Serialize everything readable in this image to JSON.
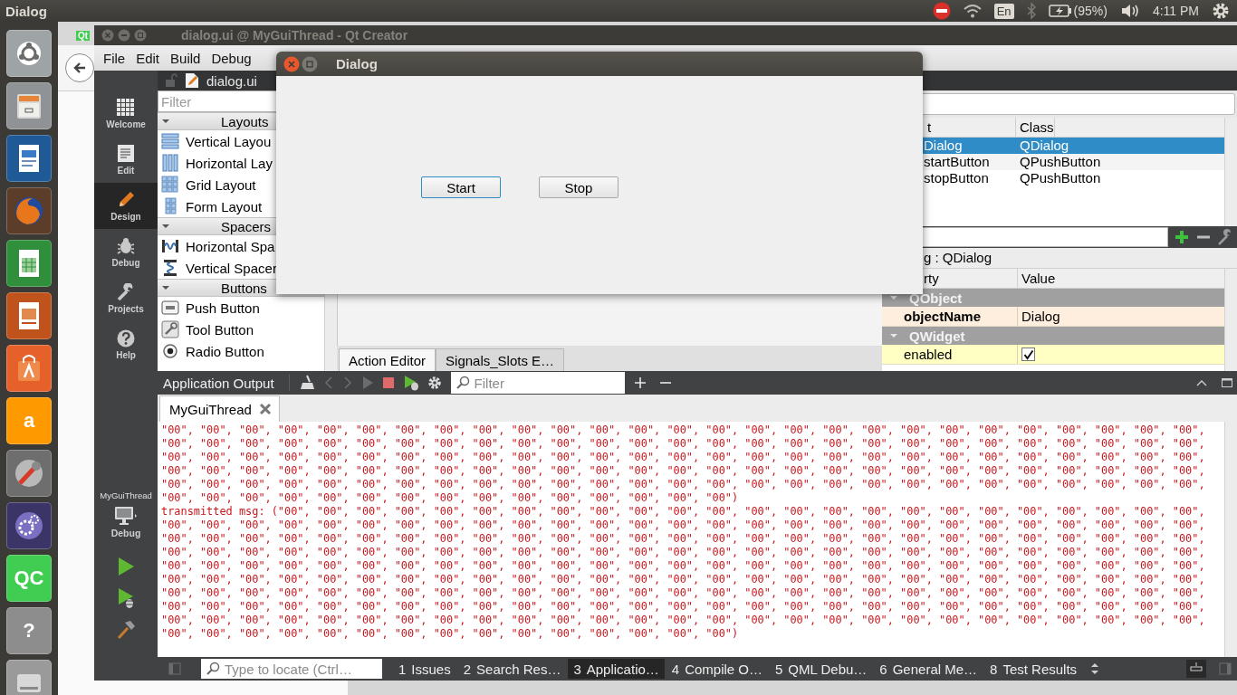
{
  "top_panel": {
    "title": "Dialog",
    "keyboard": "En",
    "battery": "(95%)",
    "clock": "4:11 PM"
  },
  "launcher": [
    {
      "kind": "ubuntu"
    },
    {
      "kind": "files"
    },
    {
      "kind": "writer"
    },
    {
      "kind": "browser"
    },
    {
      "kind": "calc"
    },
    {
      "kind": "impress"
    },
    {
      "kind": "software"
    },
    {
      "kind": "letter",
      "label": "a"
    },
    {
      "kind": "settings"
    },
    {
      "kind": "gears"
    },
    {
      "kind": "letter",
      "label": "QC"
    },
    {
      "kind": "letter",
      "label": "?"
    },
    {
      "kind": "drive"
    }
  ],
  "background_window": {
    "favicon": "Qt"
  },
  "qt_creator": {
    "title": "dialog.ui @ MyGuiThread - Qt Creator",
    "menu": [
      "File",
      "Edit",
      "Build",
      "Debug"
    ],
    "modes": [
      {
        "label": "Welcome",
        "kind": "welcome",
        "selected": false
      },
      {
        "label": "Edit",
        "kind": "edit",
        "selected": false
      },
      {
        "label": "Design",
        "kind": "design",
        "selected": true
      },
      {
        "label": "Debug",
        "kind": "debug",
        "selected": false
      },
      {
        "label": "Projects",
        "kind": "projects",
        "selected": false
      },
      {
        "label": "Help",
        "kind": "help",
        "selected": false
      }
    ],
    "kit": {
      "project": "MyGuiThread",
      "build": "Debug"
    },
    "document": "dialog.ui",
    "widget_box": {
      "placeholder": "Filter",
      "categories": [
        {
          "title": "Layouts",
          "expanded": true,
          "items": [
            {
              "label": "Vertical Layou",
              "kind": "vlayout"
            },
            {
              "label": "Horizontal Lay",
              "kind": "hlayout"
            },
            {
              "label": "Grid Layout",
              "kind": "grid"
            },
            {
              "label": "Form Layout",
              "kind": "form"
            }
          ]
        },
        {
          "title": "Spacers",
          "expanded": true,
          "items": [
            {
              "label": "Horizontal Spa",
              "kind": "hspacer"
            },
            {
              "label": "Vertical Spacer",
              "kind": "vspacer"
            }
          ]
        },
        {
          "title": "Buttons",
          "expanded": true,
          "items": [
            {
              "label": "Push Button",
              "kind": "push"
            },
            {
              "label": "Tool Button",
              "kind": "tool"
            },
            {
              "label": "Radio Button",
              "kind": "radio"
            }
          ]
        }
      ]
    },
    "form_tabs": [
      {
        "label": "Action Editor",
        "selected": true
      },
      {
        "label": "Signals_Slots E…",
        "selected": false
      }
    ],
    "object_inspector": {
      "columns": [
        "t",
        "Class"
      ],
      "rows": [
        {
          "object": "Dialog",
          "class": "QDialog",
          "selected": true
        },
        {
          "object": "startButton",
          "class": "QPushButton",
          "selected": false
        },
        {
          "object": "stopButton",
          "class": "QPushButton",
          "selected": false
        }
      ]
    },
    "property_editor": {
      "object": "g : QDialog",
      "columns": [
        "rty",
        "Value"
      ],
      "groups": [
        {
          "name": "QObject",
          "expanded": true,
          "properties": [
            {
              "name": "objectName",
              "kind": "text",
              "value": "Dialog",
              "modified": true
            }
          ]
        },
        {
          "name": "QWidget",
          "expanded": true,
          "properties": [
            {
              "name": "enabled",
              "kind": "checkbox",
              "checked": true,
              "modified": false
            }
          ]
        }
      ]
    },
    "output": {
      "title": "Application Output",
      "placeholder": "Filter",
      "tabs": [
        {
          "label": "MyGuiThread",
          "selected": true
        }
      ],
      "lines": [
        "\"00\", \"00\", \"00\", \"00\", \"00\", \"00\", \"00\", \"00\", \"00\", \"00\", \"00\", \"00\", \"00\", \"00\", \"00\", \"00\", \"00\", \"00\", \"00\", \"00\", \"00\", \"00\", \"00\", \"00\", \"00\", \"00\", \"00\",",
        "\"00\", \"00\", \"00\", \"00\", \"00\", \"00\", \"00\", \"00\", \"00\", \"00\", \"00\", \"00\", \"00\", \"00\", \"00\", \"00\", \"00\", \"00\", \"00\", \"00\", \"00\", \"00\", \"00\", \"00\", \"00\", \"00\", \"00\",",
        "\"00\", \"00\", \"00\", \"00\", \"00\", \"00\", \"00\", \"00\", \"00\", \"00\", \"00\", \"00\", \"00\", \"00\", \"00\", \"00\", \"00\", \"00\", \"00\", \"00\", \"00\", \"00\", \"00\", \"00\", \"00\", \"00\", \"00\",",
        "\"00\", \"00\", \"00\", \"00\", \"00\", \"00\", \"00\", \"00\", \"00\", \"00\", \"00\", \"00\", \"00\", \"00\", \"00\", \"00\", \"00\", \"00\", \"00\", \"00\", \"00\", \"00\", \"00\", \"00\", \"00\", \"00\", \"00\",",
        "\"00\", \"00\", \"00\", \"00\", \"00\", \"00\", \"00\", \"00\", \"00\", \"00\", \"00\", \"00\", \"00\", \"00\", \"00\", \"00\", \"00\", \"00\", \"00\", \"00\", \"00\", \"00\", \"00\", \"00\", \"00\", \"00\", \"00\",",
        "\"00\", \"00\", \"00\", \"00\", \"00\", \"00\", \"00\", \"00\", \"00\", \"00\", \"00\", \"00\", \"00\", \"00\", \"00\")",
        "transmitted msg: (\"00\", \"00\", \"00\", \"00\", \"00\", \"00\", \"00\", \"00\", \"00\", \"00\", \"00\", \"00\", \"00\", \"00\", \"00\", \"00\", \"00\", \"00\", \"00\", \"00\", \"00\", \"00\", \"00\", \"00\",",
        "\"00\", \"00\", \"00\", \"00\", \"00\", \"00\", \"00\", \"00\", \"00\", \"00\", \"00\", \"00\", \"00\", \"00\", \"00\", \"00\", \"00\", \"00\", \"00\", \"00\", \"00\", \"00\", \"00\", \"00\", \"00\", \"00\", \"00\",",
        "\"00\", \"00\", \"00\", \"00\", \"00\", \"00\", \"00\", \"00\", \"00\", \"00\", \"00\", \"00\", \"00\", \"00\", \"00\", \"00\", \"00\", \"00\", \"00\", \"00\", \"00\", \"00\", \"00\", \"00\", \"00\", \"00\", \"00\",",
        "\"00\", \"00\", \"00\", \"00\", \"00\", \"00\", \"00\", \"00\", \"00\", \"00\", \"00\", \"00\", \"00\", \"00\", \"00\", \"00\", \"00\", \"00\", \"00\", \"00\", \"00\", \"00\", \"00\", \"00\", \"00\", \"00\", \"00\",",
        "\"00\", \"00\", \"00\", \"00\", \"00\", \"00\", \"00\", \"00\", \"00\", \"00\", \"00\", \"00\", \"00\", \"00\", \"00\", \"00\", \"00\", \"00\", \"00\", \"00\", \"00\", \"00\", \"00\", \"00\", \"00\", \"00\", \"00\",",
        "\"00\", \"00\", \"00\", \"00\", \"00\", \"00\", \"00\", \"00\", \"00\", \"00\", \"00\", \"00\", \"00\", \"00\", \"00\", \"00\", \"00\", \"00\", \"00\", \"00\", \"00\", \"00\", \"00\", \"00\", \"00\", \"00\", \"00\",",
        "\"00\", \"00\", \"00\", \"00\", \"00\", \"00\", \"00\", \"00\", \"00\", \"00\", \"00\", \"00\", \"00\", \"00\", \"00\", \"00\", \"00\", \"00\", \"00\", \"00\", \"00\", \"00\", \"00\", \"00\", \"00\", \"00\", \"00\",",
        "\"00\", \"00\", \"00\", \"00\", \"00\", \"00\", \"00\", \"00\", \"00\", \"00\", \"00\", \"00\", \"00\", \"00\", \"00\", \"00\", \"00\", \"00\", \"00\", \"00\", \"00\", \"00\", \"00\", \"00\", \"00\", \"00\", \"00\",",
        "\"00\", \"00\", \"00\", \"00\", \"00\", \"00\", \"00\", \"00\", \"00\", \"00\", \"00\", \"00\", \"00\", \"00\", \"00\", \"00\", \"00\", \"00\", \"00\", \"00\", \"00\", \"00\", \"00\", \"00\", \"00\", \"00\", \"00\",",
        "\"00\", \"00\", \"00\", \"00\", \"00\", \"00\", \"00\", \"00\", \"00\", \"00\", \"00\", \"00\", \"00\", \"00\", \"00\")"
      ]
    },
    "status_bar": {
      "placeholder": "Type to locate (Ctrl…",
      "panes": [
        {
          "number": "1",
          "label": "Issues",
          "selected": false
        },
        {
          "number": "2",
          "label": "Search Res…",
          "selected": false
        },
        {
          "number": "3",
          "label": "Applicatio…",
          "selected": true
        },
        {
          "number": "4",
          "label": "Compile O…",
          "selected": false
        },
        {
          "number": "5",
          "label": "QML Debu…",
          "selected": false
        },
        {
          "number": "6",
          "label": "General Me…",
          "selected": false
        },
        {
          "number": "8",
          "label": "Test Results",
          "selected": false
        }
      ]
    }
  },
  "dialog": {
    "title": "Dialog",
    "buttons": [
      {
        "label": "Start",
        "default": true
      },
      {
        "label": "Stop",
        "default": false
      }
    ]
  }
}
